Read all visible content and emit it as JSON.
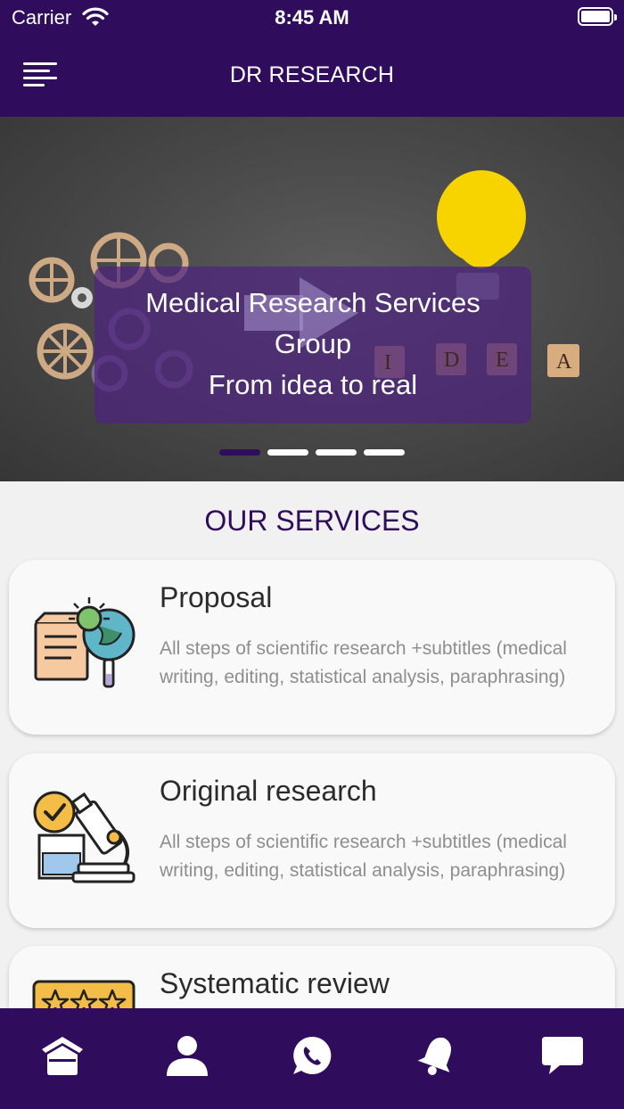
{
  "status_bar": {
    "carrier": "Carrier",
    "time": "8:45 AM"
  },
  "header": {
    "title": "DR RESEARCH",
    "menu_icon": "hamburger-menu-icon"
  },
  "banner": {
    "line1": "Medical Research Services",
    "line2": "Group",
    "line3": "From idea to real",
    "tiles": [
      "I",
      "D",
      "E",
      "A"
    ],
    "slide_count": 4,
    "active_slide": 1
  },
  "services": {
    "title": "OUR SERVICES",
    "items": [
      {
        "title": "Proposal",
        "description": "All steps of scientific research +subtitles (medical writing, editing, statistical analysis, paraphrasing)",
        "icon": "document-virus-globe-icon"
      },
      {
        "title": "Original research",
        "description": "All steps of scientific research +subtitles (medical writing, editing, statistical analysis, paraphrasing)",
        "icon": "microscope-icon"
      },
      {
        "title": "Systematic review",
        "icon": "star-rating-icon"
      }
    ]
  },
  "bottom_nav": {
    "items": [
      {
        "icon": "home-icon"
      },
      {
        "icon": "user-icon"
      },
      {
        "icon": "whatsapp-icon"
      },
      {
        "icon": "bell-icon"
      },
      {
        "icon": "chat-icon"
      }
    ]
  },
  "colors": {
    "primary": "#300d5c",
    "background": "#f1f1f1",
    "card": "#f9f9f9",
    "muted_text": "#8e8e8e"
  }
}
